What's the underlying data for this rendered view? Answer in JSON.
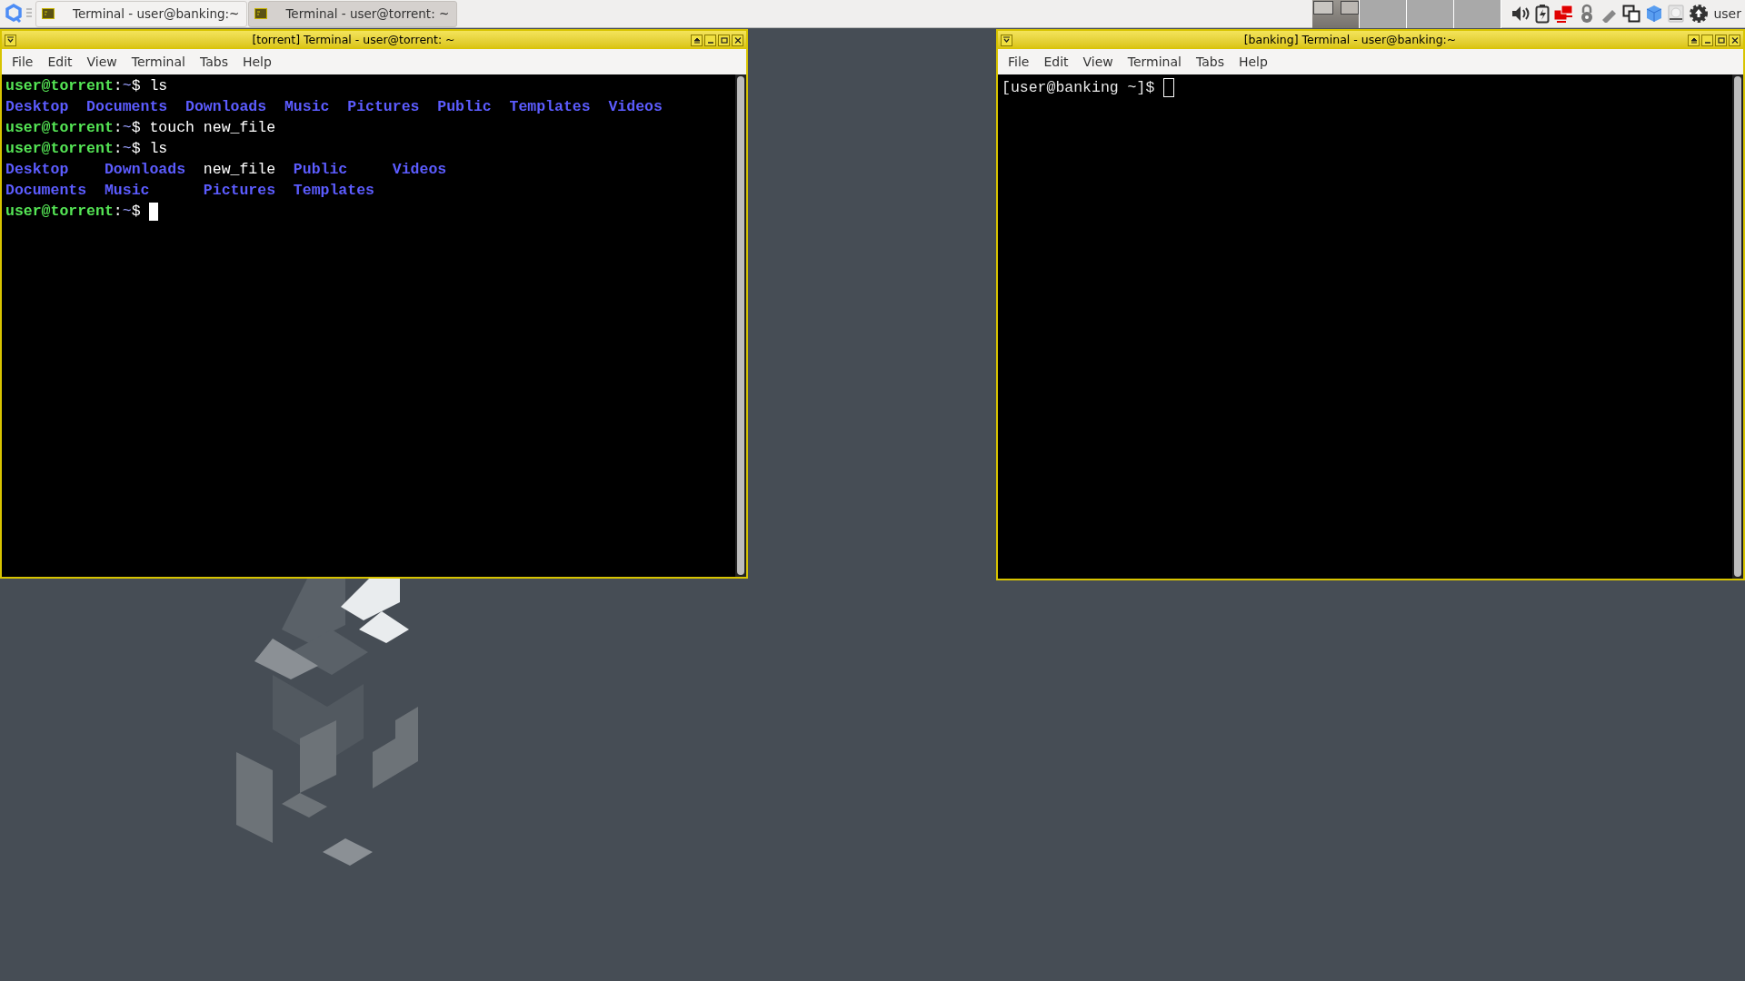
{
  "taskbar": {
    "tasks": [
      {
        "label": "Terminal - user@banking:~",
        "selected": false
      },
      {
        "label": "Terminal - user@torrent: ~",
        "selected": true
      }
    ],
    "workspaces": [
      {
        "selected": true
      },
      {
        "selected": false
      },
      {
        "selected": false
      },
      {
        "selected": false
      }
    ],
    "user": "user"
  },
  "windows": [
    {
      "title": "[torrent] Terminal - user@torrent: ~",
      "focused": true,
      "menu": [
        "File",
        "Edit",
        "View",
        "Terminal",
        "Tabs",
        "Help"
      ],
      "lines": [
        {
          "kind": "prompt",
          "user": "user@torrent",
          "sep": ":",
          "path": "~",
          "symbol": "$",
          "command": "ls"
        },
        {
          "kind": "listing",
          "columns": [
            [
              {
                "name": "Desktop",
                "kind": "dir"
              }
            ],
            [
              {
                "name": "Documents",
                "kind": "dir"
              }
            ],
            [
              {
                "name": "Downloads",
                "kind": "dir"
              }
            ],
            [
              {
                "name": "Music",
                "kind": "dir"
              }
            ],
            [
              {
                "name": "Pictures",
                "kind": "dir"
              }
            ],
            [
              {
                "name": "Public",
                "kind": "dir"
              }
            ],
            [
              {
                "name": "Templates",
                "kind": "dir"
              }
            ],
            [
              {
                "name": "Videos",
                "kind": "dir"
              }
            ]
          ]
        },
        {
          "kind": "prompt",
          "user": "user@torrent",
          "sep": ":",
          "path": "~",
          "symbol": "$",
          "command": "touch new_file"
        },
        {
          "kind": "prompt",
          "user": "user@torrent",
          "sep": ":",
          "path": "~",
          "symbol": "$",
          "command": "ls"
        },
        {
          "kind": "listing",
          "columns": [
            [
              {
                "name": "Desktop",
                "kind": "dir"
              },
              {
                "name": "Documents",
                "kind": "dir"
              }
            ],
            [
              {
                "name": "Downloads",
                "kind": "dir"
              },
              {
                "name": "Music",
                "kind": "dir"
              }
            ],
            [
              {
                "name": "new_file",
                "kind": "file"
              },
              {
                "name": "Pictures",
                "kind": "dir"
              }
            ],
            [
              {
                "name": "Public",
                "kind": "dir"
              },
              {
                "name": "Templates",
                "kind": "dir"
              }
            ],
            [
              {
                "name": "Videos",
                "kind": "dir"
              }
            ]
          ]
        },
        {
          "kind": "prompt",
          "user": "user@torrent",
          "sep": ":",
          "path": "~",
          "symbol": "$",
          "cursor": true
        }
      ]
    },
    {
      "title": "[banking] Terminal - user@banking:~",
      "focused": false,
      "menu": [
        "File",
        "Edit",
        "View",
        "Terminal",
        "Tabs",
        "Help"
      ],
      "lines": [
        {
          "kind": "plain",
          "text": "[user@banking ~]$",
          "cursor": true
        }
      ]
    }
  ]
}
